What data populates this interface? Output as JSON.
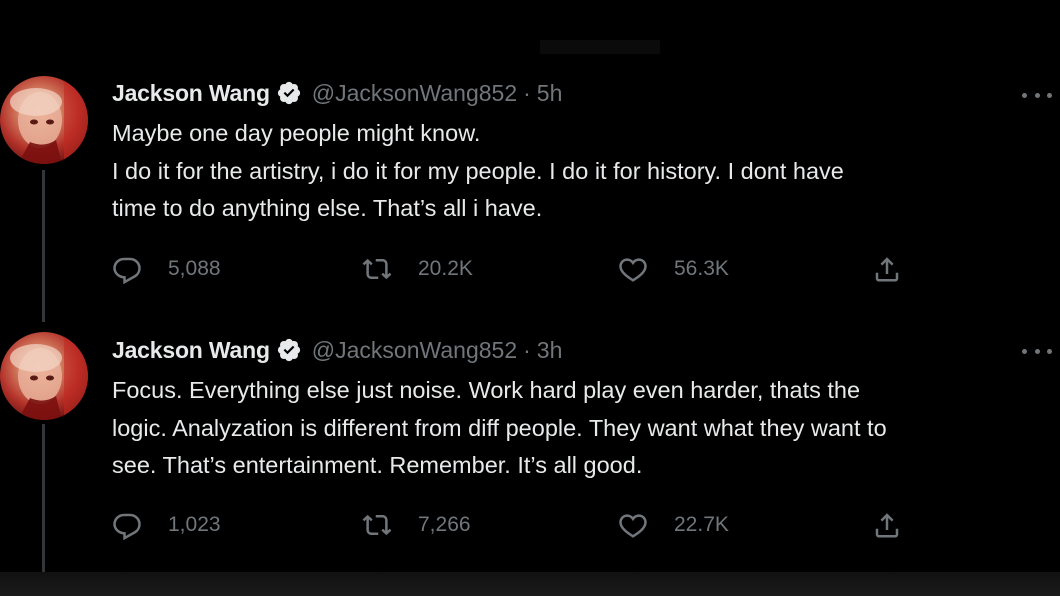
{
  "tweets": [
    {
      "author": {
        "name": "Jackson Wang",
        "handle": "@JacksonWang852",
        "verified": true
      },
      "time": "5h",
      "separator": "·",
      "lines": [
        "Maybe one day people might know.",
        "I do it for the artistry, i do it for my people. I do it for history. I dont have",
        "time to do anything else. That’s all i have."
      ],
      "replies": "5,088",
      "retweets": "20.2K",
      "likes": "56.3K"
    },
    {
      "author": {
        "name": "Jackson Wang",
        "handle": "@JacksonWang852",
        "verified": true
      },
      "time": "3h",
      "separator": "·",
      "lines": [
        "Focus. Everything else just noise. Work hard play even harder, thats the",
        "logic. Analyzation is different from diff people. They want what they want to",
        "see. That’s entertainment. Remember. It’s all good."
      ],
      "replies": "1,023",
      "retweets": "7,266",
      "likes": "22.7K"
    }
  ],
  "icons": {
    "reply": "reply-icon",
    "retweet": "retweet-icon",
    "like": "heart-icon",
    "share": "share-icon",
    "more": "more-icon",
    "verified": "verified-badge-icon"
  },
  "colors": {
    "background": "#000000",
    "text": "#e7e9ea",
    "muted": "#71767b",
    "thread_line": "#333639"
  }
}
